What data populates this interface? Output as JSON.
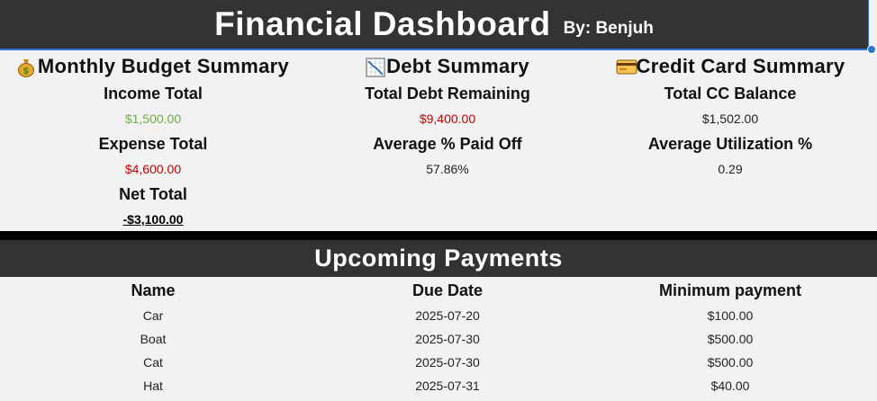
{
  "header": {
    "title": "Financial Dashboard",
    "subtitle": "By: Benjuh"
  },
  "budget": {
    "heading": "Monthly Budget Summary",
    "icon": "money-bag-icon",
    "income_label": "Income Total",
    "income_value": "$1,500.00",
    "expense_label": "Expense Total",
    "expense_value": "$4,600.00",
    "net_label": "Net Total",
    "net_value": "-$3,100.00"
  },
  "debt": {
    "heading": "Debt Summary",
    "icon": "chart-decreasing-icon",
    "remaining_label": "Total Debt Remaining",
    "remaining_value": "$9,400.00",
    "paid_label": "Average % Paid Off",
    "paid_value": "57.86%"
  },
  "credit": {
    "heading": "Credit Card Summary",
    "icon": "credit-card-icon",
    "balance_label": "Total CC Balance",
    "balance_value": "$1,502.00",
    "util_label": "Average Utilization %",
    "util_value": "0.29"
  },
  "payments": {
    "heading": "Upcoming Payments",
    "columns": [
      "Name",
      "Due Date",
      "Minimum payment"
    ],
    "rows": [
      {
        "name": "Car",
        "due": "2025-07-20",
        "min": "$100.00"
      },
      {
        "name": "Boat",
        "due": "2025-07-30",
        "min": "$500.00"
      },
      {
        "name": "Cat",
        "due": "2025-07-30",
        "min": "$500.00"
      },
      {
        "name": "Hat",
        "due": "2025-07-31",
        "min": "$40.00"
      }
    ]
  },
  "colors": {
    "bar": "#333333",
    "income": "#70ad47",
    "expense": "#c00000",
    "selection": "#2f74d0"
  }
}
